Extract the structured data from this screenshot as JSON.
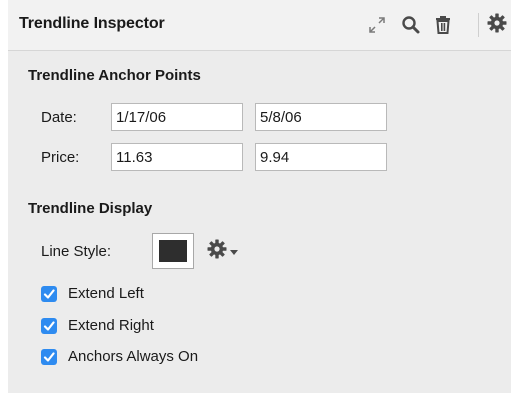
{
  "header": {
    "title": "Trendline Inspector",
    "icons": [
      "expand-icon",
      "search-icon",
      "trash-icon",
      "gear-icon",
      "chevron-down-icon"
    ]
  },
  "anchor_points": {
    "section_title": "Trendline Anchor Points",
    "date_label": "Date:",
    "date_start": "1/17/06",
    "date_end": "5/8/06",
    "price_label": "Price:",
    "price_start": "11.63",
    "price_end": "9.94"
  },
  "display": {
    "section_title": "Trendline Display",
    "line_style_label": "Line Style:",
    "line_color": "#2e2e2e",
    "options": [
      {
        "label": "Extend Left",
        "checked": true
      },
      {
        "label": "Extend Right",
        "checked": true
      },
      {
        "label": "Anchors Always On",
        "checked": true
      }
    ]
  },
  "colors": {
    "checkbox_accent": "#2e8bf0",
    "panel_background": "#ececec"
  }
}
